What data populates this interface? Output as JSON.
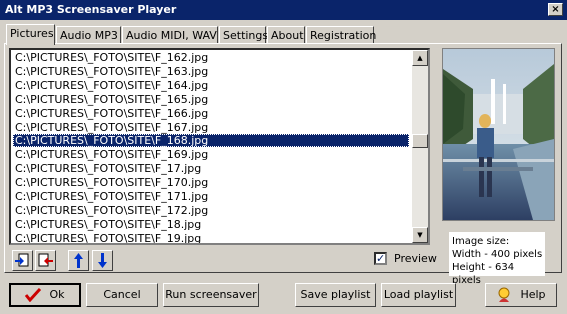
{
  "window": {
    "title": "Alt MP3 Screensaver Player",
    "close_glyph": "×"
  },
  "tabs": [
    {
      "label": "Pictures",
      "active": true
    },
    {
      "label": "Audio MP3",
      "active": false
    },
    {
      "label": "Audio MIDI, WAV",
      "active": false
    },
    {
      "label": "Settings",
      "active": false
    },
    {
      "label": "About",
      "active": false
    },
    {
      "label": "Registration",
      "active": false
    }
  ],
  "file_list": {
    "items": [
      "C:\\PICTURES\\_FOTO\\SITE\\F_162.jpg",
      "C:\\PICTURES\\_FOTO\\SITE\\F_163.jpg",
      "C:\\PICTURES\\_FOTO\\SITE\\F_164.jpg",
      "C:\\PICTURES\\_FOTO\\SITE\\F_165.jpg",
      "C:\\PICTURES\\_FOTO\\SITE\\F_166.jpg",
      "C:\\PICTURES\\_FOTO\\SITE\\F_167.jpg",
      "C:\\PICTURES\\_FOTO\\SITE\\F_168.jpg",
      "C:\\PICTURES\\_FOTO\\SITE\\F_169.jpg",
      "C:\\PICTURES\\_FOTO\\SITE\\F_17.jpg",
      "C:\\PICTURES\\_FOTO\\SITE\\F_170.jpg",
      "C:\\PICTURES\\_FOTO\\SITE\\F_171.jpg",
      "C:\\PICTURES\\_FOTO\\SITE\\F_172.jpg",
      "C:\\PICTURES\\_FOTO\\SITE\\F_18.jpg",
      "C:\\PICTURES\\_FOTO\\SITE\\F_19.jpg"
    ],
    "selected_index": 6
  },
  "preview": {
    "checkbox_label": "Preview",
    "checked": true,
    "image_size_label": "Image size:",
    "width_text": "Width - 400 pixels",
    "height_text": "Height - 634 pixels"
  },
  "buttons": {
    "ok": "Ok",
    "cancel": "Cancel",
    "run": "Run screensaver",
    "save_playlist": "Save playlist",
    "load_playlist": "Load playlist",
    "help": "Help"
  },
  "colors": {
    "selection": "#0a246a",
    "titlebar": "#0a246a",
    "face": "#d4d0c8"
  },
  "icons": [
    "add-files-icon",
    "remove-files-icon",
    "move-up-icon",
    "move-down-icon",
    "checkmark-icon",
    "help-icon",
    "scroll-up-icon",
    "scroll-down-icon"
  ]
}
